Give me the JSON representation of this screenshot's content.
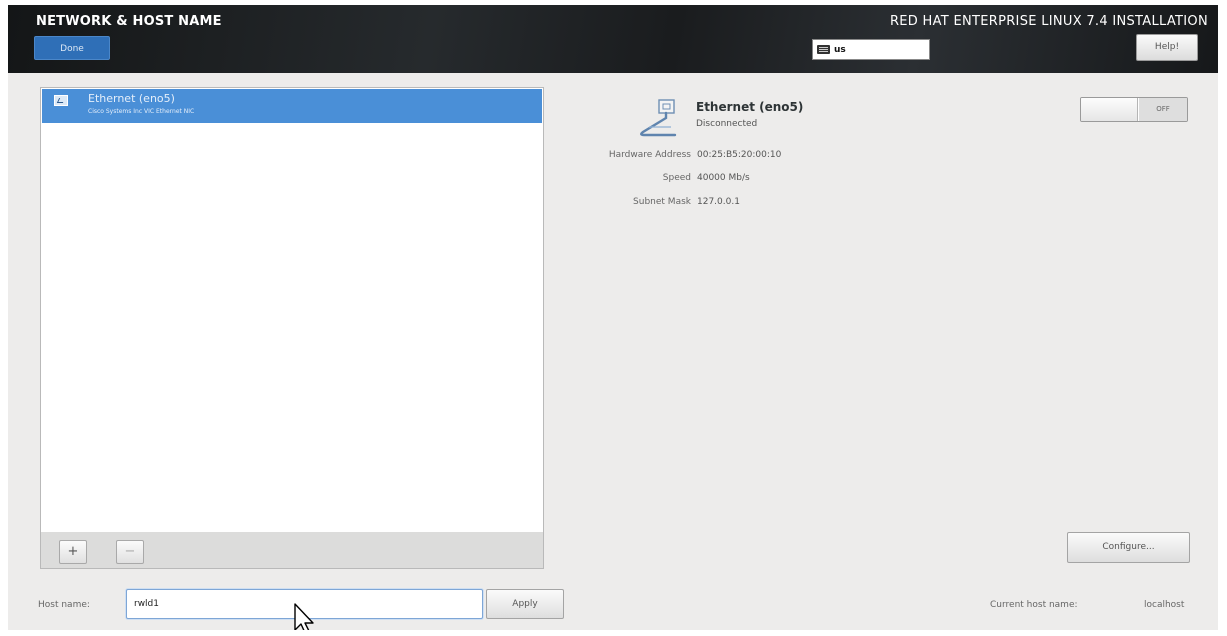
{
  "header": {
    "spoke_title": "NETWORK & HOST NAME",
    "done_label": "Done",
    "product_title": "RED HAT ENTERPRISE LINUX 7.4 INSTALLATION",
    "keyboard_layout": "us",
    "help_label": "Help!"
  },
  "devices": [
    {
      "name": "Ethernet (eno5)",
      "description": "Cisco Systems Inc VIC Ethernet NIC",
      "selected": true
    }
  ],
  "list_toolbar": {
    "add_label": "+",
    "remove_label": "−"
  },
  "detail": {
    "title": "Ethernet (eno5)",
    "status": "Disconnected",
    "toggle_label": "OFF",
    "properties": [
      {
        "label": "Hardware Address",
        "value": "00:25:B5:20:00:10"
      },
      {
        "label": "Speed",
        "value": "40000 Mb/s"
      },
      {
        "label": "Subnet Mask",
        "value": "127.0.0.1"
      }
    ],
    "configure_label": "Configure..."
  },
  "hostname": {
    "label": "Host name:",
    "value": "rwld1",
    "apply_label": "Apply",
    "current_label": "Current host name:",
    "current_value": "localhost"
  },
  "colors": {
    "selection": "#4a8fd7",
    "done_button": "#2f6fb7",
    "header_bg": "#1d2022",
    "panel_bg": "#edeceb"
  },
  "icons": {
    "device_row": "network-wired-icon",
    "detail": "ethernet-cable-icon",
    "keyboard": "keyboard-icon",
    "cursor": "mouse-pointer-icon"
  }
}
